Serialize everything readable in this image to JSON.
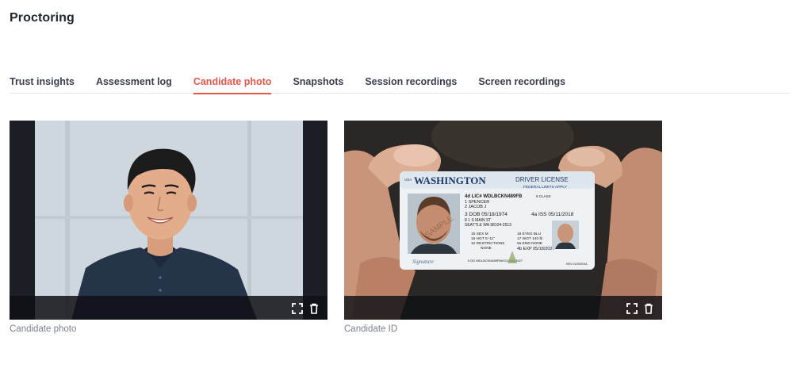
{
  "page": {
    "title": "Proctoring"
  },
  "tabs": [
    {
      "label": "Trust insights",
      "active": false
    },
    {
      "label": "Assessment log",
      "active": false
    },
    {
      "label": "Candidate photo",
      "active": true
    },
    {
      "label": "Snapshots",
      "active": false
    },
    {
      "label": "Session recordings",
      "active": false
    },
    {
      "label": "Screen recordings",
      "active": false
    }
  ],
  "colors": {
    "accent": "#e2574c",
    "text": "#22262f",
    "caption": "#7a808c"
  },
  "cards": [
    {
      "caption": "Candidate photo",
      "image": "candidate-portrait",
      "actions": [
        "expand-icon",
        "trash-icon"
      ]
    },
    {
      "caption": "Candidate ID",
      "image": "id-card-held",
      "actions": [
        "expand-icon",
        "trash-icon"
      ],
      "id_card": {
        "state": "WASHINGTON",
        "type": "DRIVER LICENSE",
        "note": "FEDERAL LIMITS APPLY",
        "usa": "USA",
        "number": "4d LIC# WDLBCKN489FB",
        "class": "9 CLASS",
        "last_name": "1 SPENCER",
        "first_name": "2 JACOB J",
        "dob": "3 DOB 05/18/1974",
        "iss": "4a ISS 05/11/2018",
        "addr1": "8 1 S MAIN ST",
        "addr2": "SEATTLE WA 98104-2513",
        "sex": "15 SEX  M",
        "hgt": "16 HGT  5'-11\"",
        "restrictions": "12 RESTRICTIONS",
        "none1": "NONE",
        "eyes": "18 EYES BLU",
        "wgt": "17 WGT  140 lb",
        "end": "9a END  NONE",
        "exp": "4b EXP  05/18/2024",
        "signature": "Signature",
        "dd": "5 DD WDLBCKN489FB#S1118A23927",
        "rev": "REV 01/09/2018",
        "sample": "SAMPLE"
      }
    }
  ]
}
